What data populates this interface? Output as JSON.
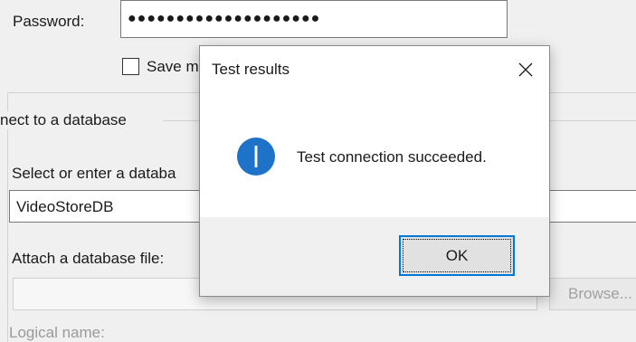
{
  "background": {
    "password_label": "Password:",
    "password_value": "●●●●●●●●●●●●●●●●●●●●",
    "save_label": "Save m",
    "group_title": "nect to a database",
    "database_label": "Select or enter a databa",
    "database_value": "VideoStoreDB",
    "attach_label": "Attach a database file:",
    "browse_label": "Browse...",
    "logical_label": "Logical name:"
  },
  "modal": {
    "title": "Test results",
    "message": "Test connection succeeded.",
    "ok_label": "OK",
    "icon": "info-icon",
    "accent": "#0078d7"
  }
}
